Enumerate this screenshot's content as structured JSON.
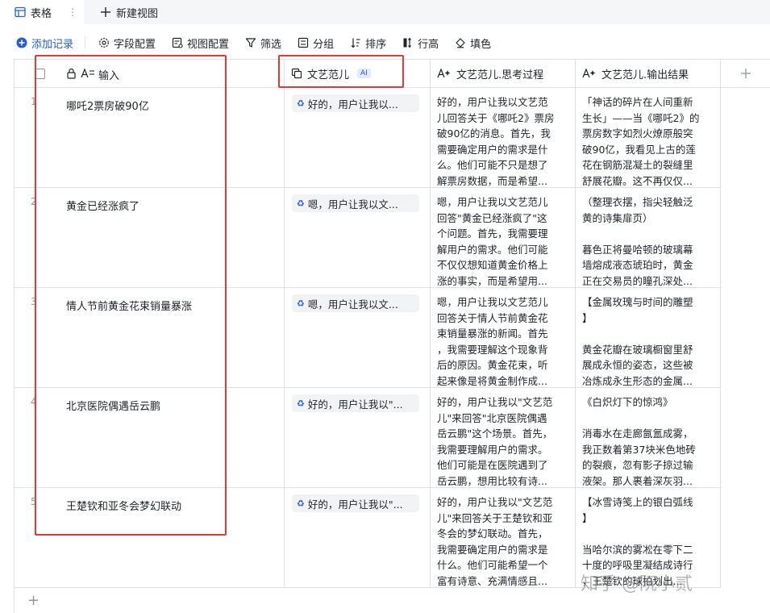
{
  "view_bar": {
    "tab_label": "表格",
    "tab_more": "⋮",
    "new_view_label": "新建视图"
  },
  "toolbar": {
    "add_record": "添加记录",
    "field_config": "字段配置",
    "view_config": "视图配置",
    "filter": "筛选",
    "group": "分组",
    "sort": "排序",
    "row_height": "行高",
    "fill": "填色"
  },
  "columns": {
    "input": "输入",
    "wenyi": "文艺范儿",
    "wenyi_ai_badge": "AI",
    "thinking": "文艺范儿.思考过程",
    "output": "文艺范儿.输出结果"
  },
  "rows": [
    {
      "num": "1",
      "input": "哪吒2票房破90亿",
      "chip": "好的，用户让我以...",
      "thinking": "好的，用户让我以文艺范\n儿回答关于《哪吒2》票房\n破90亿的消息。首先，我\n需要确定用户的需求是什\n么。他们可能不只是想了\n解票房数据，而是希望...",
      "output": "「神话的碎片在人间重新\n生长」——当《哪吒2》的\n票房数字如烈火燎原般突\n破90亿，我看见上古的莲\n花在钢筋混凝土的裂缝里\n舒展花瓣。这不再仅仅..."
    },
    {
      "num": "2",
      "input": "黄金已经涨疯了",
      "chip": "嗯，用户让我以文...",
      "thinking": "嗯，用户让我以文艺范儿\n回答\"黄金已经涨疯了\"这\n个问题。首先，我需要理\n解用户的需求。他们可能\n不仅仅想知道黄金价格上\n涨的事实，而是希望用...",
      "output": "（整理衣摆，指尖轻触泛\n黄的诗集扉页）\n\n暮色正将曼哈顿的玻璃幕\n墙熔成液态琥珀时，黄金\n正在交易员的瞳孔深处..."
    },
    {
      "num": "3",
      "input": "情人节前黄金花束销量暴涨",
      "chip": "嗯，用户让我以文...",
      "thinking": "嗯，用户让我以文艺范儿\n回答关于情人节前黄金花\n束销量暴涨的新闻。首先\n，我需要理解这个现象背\n后的原因。黄金花束，听\n起来像是将黄金制作成...",
      "output": "【金属玫瑰与时间的雕塑\n】\n\n黄金花瓣在玻璃橱窗里舒\n展成永恒的姿态，这些被\n冶炼成永生形态的金属..."
    },
    {
      "num": "4",
      "input": "北京医院偶遇岳云鹏",
      "chip": "好的，用户让我以\"...",
      "thinking": "好的，用户让我以\"文艺范\n儿\"来回答\"北京医院偶遇\n岳云鹏\"这个场景。首先，\n我需要理解用户的需求。\n他们可能是在医院遇到了\n岳云鹏，想用比较有诗...",
      "output": "《白炽灯下的惊鸿》\n\n消毒水在走廊氤氲成雾，\n我正数着第37块米色地砖\n的裂痕，忽有影子掠过输\n液架。那人裹着深灰羽..."
    },
    {
      "num": "5",
      "input": "王楚钦和亚冬会梦幻联动",
      "chip": "好的，用户让我以\"...",
      "thinking": "好的，用户让我以\"文艺范\n儿\"来回答关于王楚钦和亚\n冬会的梦幻联动。首先，\n我需要确定用户的需求是\n什么。他们可能希望一个\n富有诗意、充满情感且...",
      "output": "【冰雪诗笺上的银白弧线\n】\n\n当哈尔滨的雾凇在零下二\n十度的呼吸里凝结成诗行\n，王楚钦的球拍划出..."
    }
  ],
  "watermark": "知乎 @阮小贰",
  "colors": {
    "accent": "#245bdb",
    "highlight_box": "#e23a3a",
    "border": "#dee0e3"
  }
}
